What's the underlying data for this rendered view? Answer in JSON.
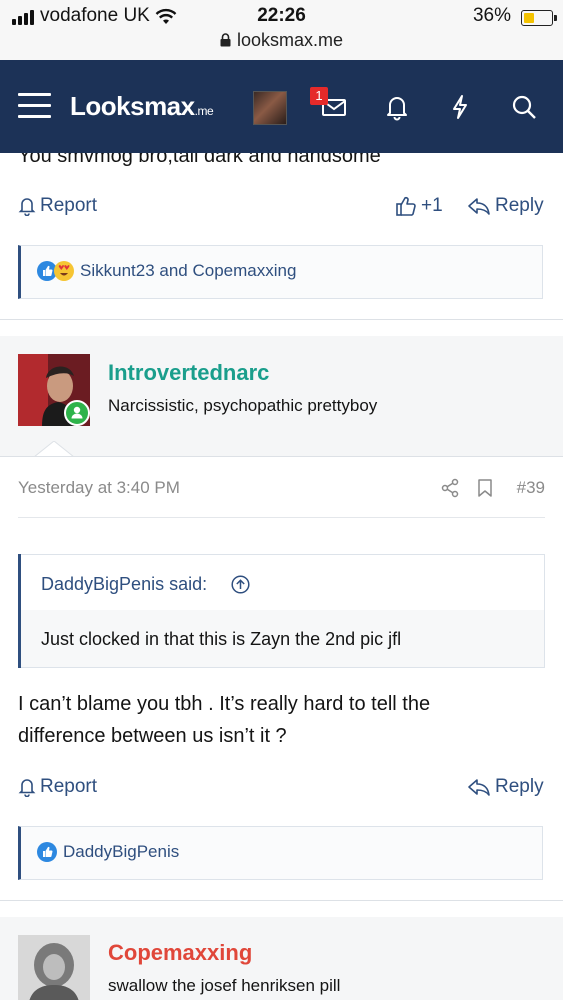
{
  "status_bar": {
    "carrier": "vodafone UK",
    "time": "22:26",
    "battery_percent": "36%",
    "battery_level": 0.36,
    "url": "looksmax.me"
  },
  "nav": {
    "logo_main": "Looksmax",
    "logo_suffix": ".me",
    "inbox_badge": "1",
    "colors": {
      "bar": "#1c3257"
    }
  },
  "prev_post": {
    "cut_text": "You smvmog bro,tall dark and handsome",
    "report_label": "Report",
    "like_label": "+1",
    "reply_label": "Reply",
    "reactions_text": "Sikkunt23 and Copemaxxing"
  },
  "post": {
    "username": "Introvertednarc",
    "user_title": "Narcissistic, psychopathic prettyboy",
    "timestamp": "Yesterday at 3:40 PM",
    "post_number": "#39",
    "quote_author": "DaddyBigPenis said:",
    "quote_text": "Just clocked in that this is Zayn the 2nd pic jfl",
    "body_line1": "I can’t blame you tbh . It’s really hard to tell the",
    "body_line2": "difference between us isn’t it ?",
    "report_label": "Report",
    "reply_label": "Reply",
    "reactions_text": "DaddyBigPenis",
    "username_color": "#1a9e8c"
  },
  "next_post": {
    "username": "Copemaxxing",
    "user_title": "swallow the josef henriksen pill",
    "username_color": "#e0473a"
  }
}
